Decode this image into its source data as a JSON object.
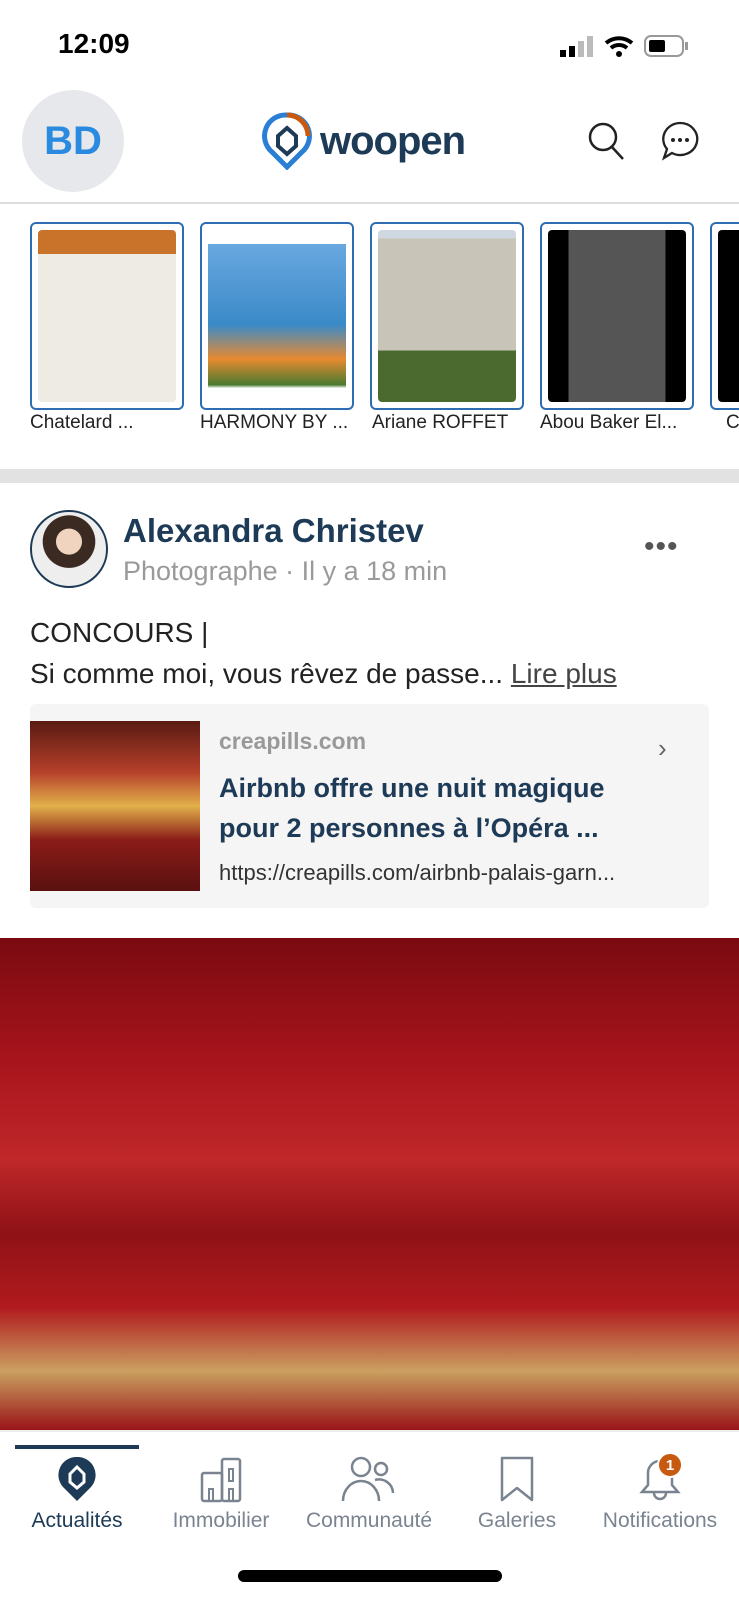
{
  "status_bar": {
    "time": "12:09"
  },
  "header": {
    "avatar_initials": "BD",
    "logo_text": "woopen",
    "colors": {
      "brand": "#1d3a56",
      "accent": "#c75a10",
      "avatar_text": "#2a8ae0"
    }
  },
  "stories": [
    {
      "label": "Chatelard  ..."
    },
    {
      "label": "HARMONY BY ..."
    },
    {
      "label": "Ariane  ROFFET"
    },
    {
      "label": "Abou Baker El..."
    },
    {
      "label": "C"
    }
  ],
  "post": {
    "author": "Alexandra Christev",
    "subtitle": "Photographe · Il y a 18 min",
    "text_line1": "CONCOURS |",
    "text_line2": "Si comme moi, vous rêvez de passe...",
    "read_more": "Lire plus",
    "link": {
      "domain": "creapills.com",
      "title": "Airbnb offre une nuit magique pour 2 personnes à l’Opéra ...",
      "url": "https://creapills.com/airbnb-palais-garn..."
    }
  },
  "tabs": [
    {
      "label": "Actualités",
      "active": true
    },
    {
      "label": "Immobilier"
    },
    {
      "label": "Communauté"
    },
    {
      "label": "Galeries"
    },
    {
      "label": "Notifications",
      "badge": "1"
    }
  ]
}
